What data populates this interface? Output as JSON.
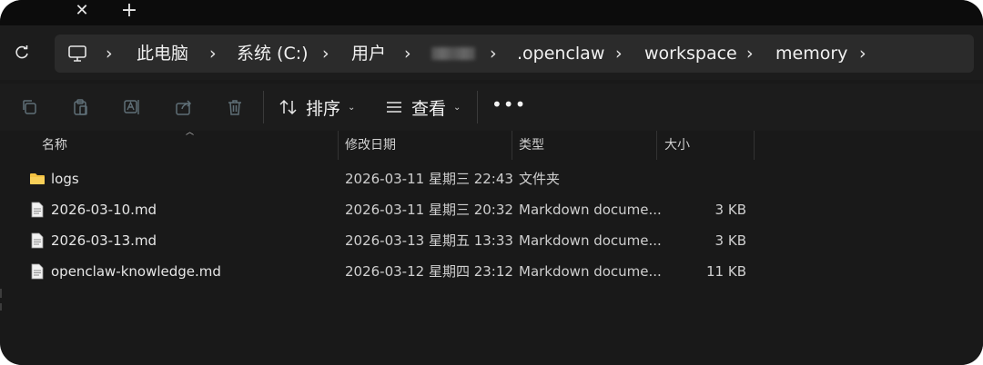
{
  "tabbar": {
    "close_glyph": "✕",
    "new_tab_glyph": "+"
  },
  "breadcrumb": {
    "items": [
      "此电脑",
      "系统 (C:)",
      "用户",
      ".openclaw",
      "workspace",
      "memory"
    ],
    "separator": "›"
  },
  "command_bar": {
    "sort_label": "排序",
    "view_label": "查看",
    "more_label": "•••"
  },
  "columns": {
    "name": "名称",
    "modified": "修改日期",
    "type": "类型",
    "size": "大小"
  },
  "files": [
    {
      "name": "logs",
      "modified": "2026-03-11 星期三 22:43",
      "type": "文件夹",
      "size": "",
      "icon": "folder-icon"
    },
    {
      "name": "2026-03-10.md",
      "modified": "2026-03-11 星期三 20:32",
      "type": "Markdown docume...",
      "size": "3 KB",
      "icon": "file-icon"
    },
    {
      "name": "2026-03-13.md",
      "modified": "2026-03-13 星期五 13:33",
      "type": "Markdown docume...",
      "size": "3 KB",
      "icon": "file-icon"
    },
    {
      "name": "openclaw-knowledge.md",
      "modified": "2026-03-12 星期四 23:12",
      "type": "Markdown docume...",
      "size": "11 KB",
      "icon": "file-icon"
    }
  ],
  "colors": {
    "window_bg": "#191919",
    "folder": "#f4c242",
    "text": "#e6e6e6"
  }
}
